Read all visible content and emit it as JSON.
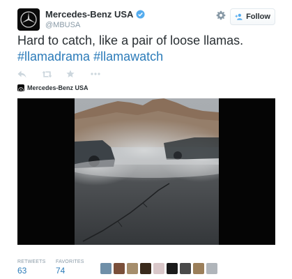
{
  "author": {
    "display_name": "Mercedes-Benz USA",
    "handle": "@MBUSA",
    "verified": true,
    "avatar_icon": "mercedes-star-logo"
  },
  "follow_button": {
    "label": "Follow",
    "icon": "add-user-icon"
  },
  "settings_icon": "gear-icon",
  "tweet": {
    "text": "Hard to catch, like a pair of loose llamas.",
    "hashtags": [
      "#llamadrama",
      "#llamawatch"
    ]
  },
  "actions": [
    "reply-icon",
    "retweet-icon",
    "favorite-icon",
    "more-icon"
  ],
  "card": {
    "author_name": "Mercedes-Benz USA",
    "media": "video-drifting-cars"
  },
  "stats": {
    "retweets_label": "RETWEETS",
    "retweets_count": "63",
    "favorites_label": "FAVORITES",
    "favorites_count": "74"
  },
  "favoriter_avatar_colors": [
    "#6f8fa8",
    "#7a4f3a",
    "#a58d6c",
    "#3a2a1c",
    "#d9c7c9",
    "#1a1a1a",
    "#4a4a4a",
    "#9b7f5a",
    "#b0b5ba"
  ],
  "colors": {
    "link": "#2b7bb9",
    "verified": "#55acee",
    "muted": "#8899a6",
    "text": "#292f33"
  }
}
